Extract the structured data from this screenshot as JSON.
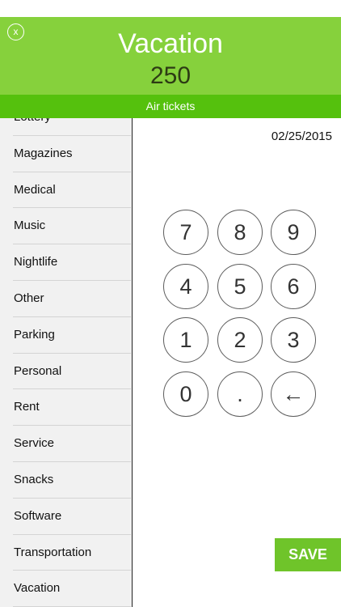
{
  "header": {
    "close_label": "x",
    "title": "Vacation",
    "amount": "250",
    "subcategory": "Air tickets"
  },
  "sidebar": {
    "items": [
      {
        "label": "Lottery"
      },
      {
        "label": "Magazines"
      },
      {
        "label": "Medical"
      },
      {
        "label": "Music"
      },
      {
        "label": "Nightlife"
      },
      {
        "label": "Other"
      },
      {
        "label": "Parking"
      },
      {
        "label": "Personal"
      },
      {
        "label": "Rent"
      },
      {
        "label": "Service"
      },
      {
        "label": "Snacks"
      },
      {
        "label": "Software"
      },
      {
        "label": "Transportation"
      },
      {
        "label": "Vacation"
      }
    ]
  },
  "date": "02/25/2015",
  "keypad": {
    "keys": [
      "7",
      "8",
      "9",
      "4",
      "5",
      "6",
      "1",
      "2",
      "3",
      "0",
      ".",
      "←"
    ]
  },
  "save_label": "SAVE",
  "colors": {
    "header_green": "#86d13c",
    "subbar_green": "#55c10d",
    "save_green": "#6fc42a"
  }
}
